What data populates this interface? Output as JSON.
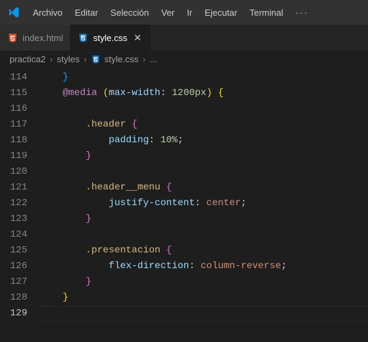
{
  "menu": {
    "items": [
      "Archivo",
      "Editar",
      "Selección",
      "Ver",
      "Ir",
      "Ejecutar",
      "Terminal"
    ],
    "more": "···"
  },
  "tabs": [
    {
      "label": "index.html",
      "icon": "html5",
      "active": false
    },
    {
      "label": "style.css",
      "icon": "css3",
      "active": true
    }
  ],
  "breadcrumbs": {
    "items": [
      "practica2",
      "styles",
      "style.css"
    ],
    "ellipsis": "..."
  },
  "gutter": {
    "start": 114,
    "end": 129,
    "current": 129
  },
  "code": {
    "l114": "}",
    "l115": {
      "at": "@media",
      "paren_open": "(",
      "prop": "max-width",
      "colon": ":",
      "sp": " ",
      "num": "1200px",
      "paren_close": ")",
      "sp2": " ",
      "brace": "{"
    },
    "l117": {
      "sel": ".header",
      "sp": " ",
      "brace": "{"
    },
    "l118": {
      "prop": "padding",
      "colon": ":",
      "sp": " ",
      "num": "10%",
      "semi": ";"
    },
    "l119": {
      "brace": "}"
    },
    "l121": {
      "sel": ".header__menu",
      "sp": " ",
      "brace": "{"
    },
    "l122": {
      "prop": "justify-content",
      "colon": ":",
      "sp": " ",
      "val": "center",
      "semi": ";"
    },
    "l123": {
      "brace": "}"
    },
    "l125": {
      "sel": ".presentacion",
      "sp": " ",
      "brace": "{"
    },
    "l126": {
      "prop": "flex-direction",
      "colon": ":",
      "sp": " ",
      "val": "column-reverse",
      "semi": ";"
    },
    "l127": {
      "brace": "}"
    },
    "l128": {
      "brace": "}"
    }
  }
}
